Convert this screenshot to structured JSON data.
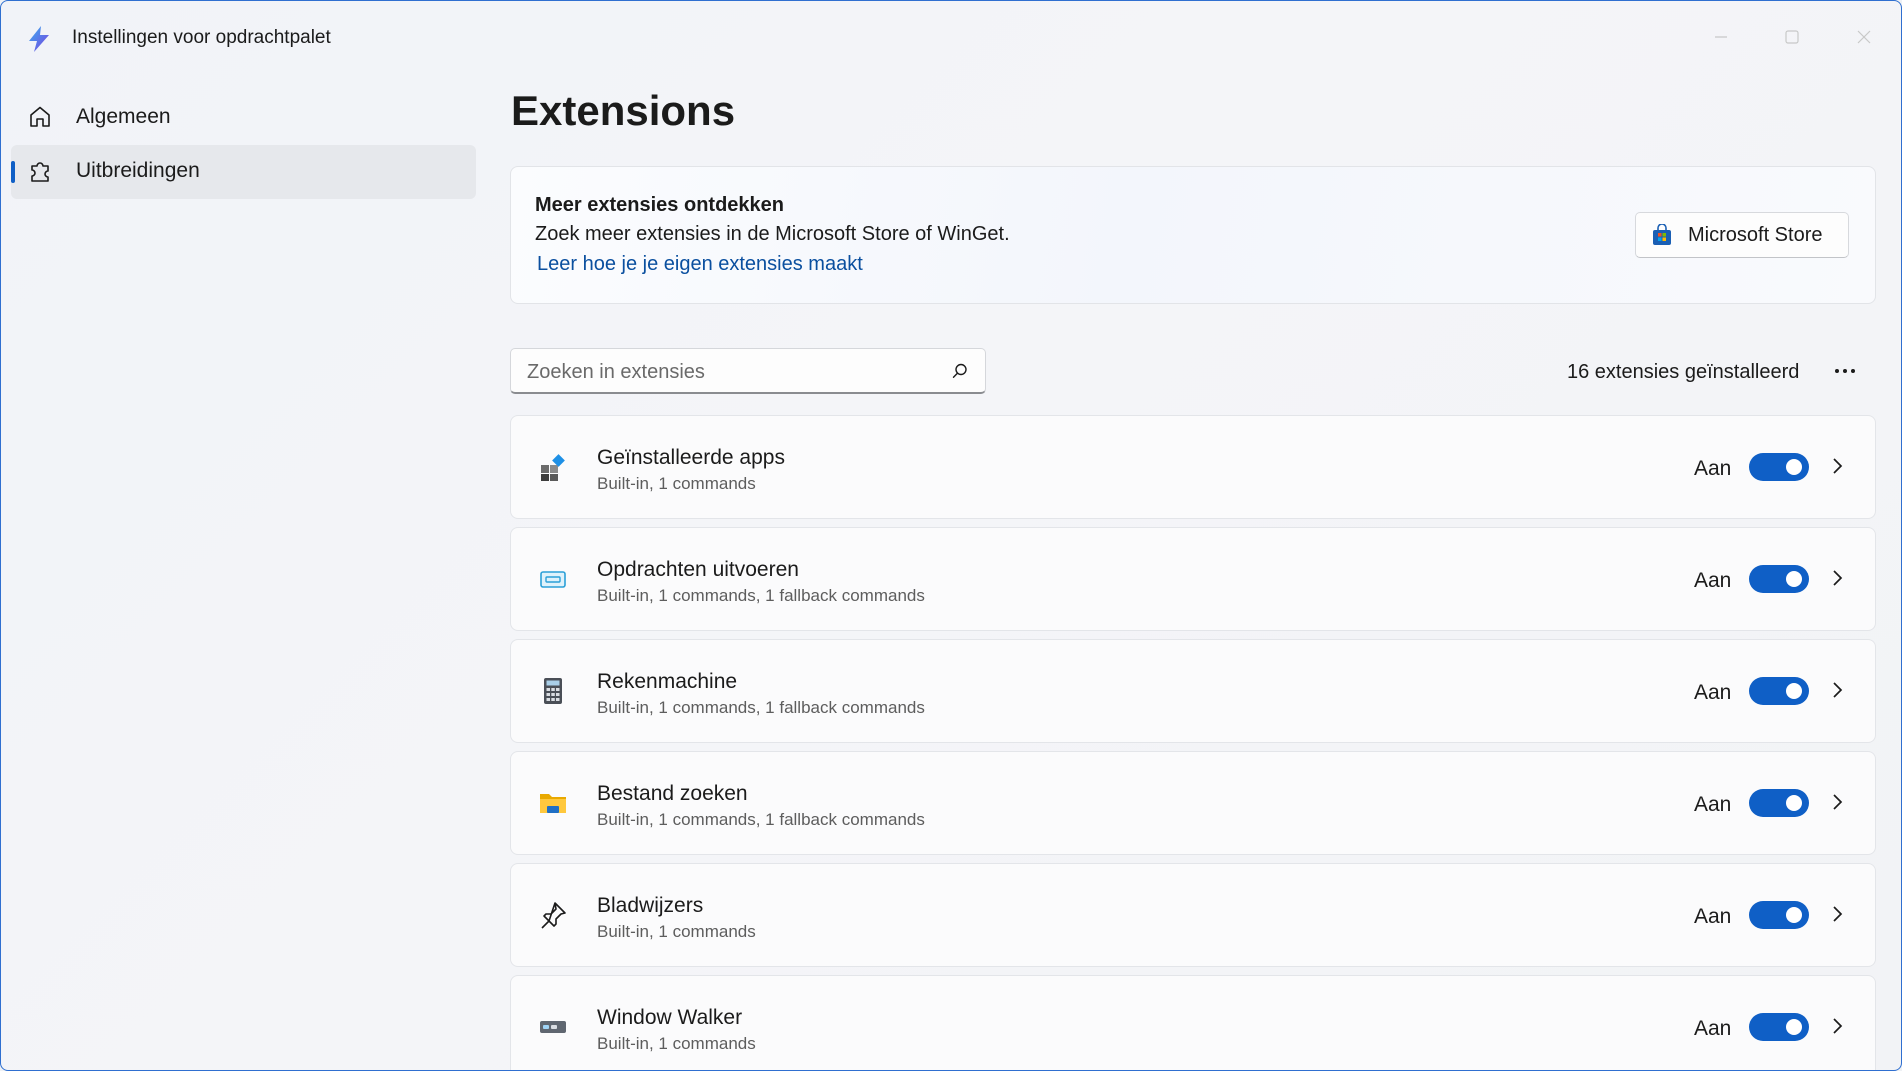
{
  "window": {
    "title": "Instellingen voor opdrachtpalet",
    "accent_color": "#0f5fc6"
  },
  "sidebar": {
    "items": [
      {
        "label": "Algemeen",
        "icon": "home-icon",
        "selected": false
      },
      {
        "label": "Uitbreidingen",
        "icon": "puzzle-icon",
        "selected": true
      }
    ]
  },
  "main": {
    "title": "Extensions",
    "discover": {
      "title": "Meer extensies ontdekken",
      "description": "Zoek meer extensies in de Microsoft Store of WinGet.",
      "link": "Leer hoe je je eigen extensies maakt",
      "store_button": "Microsoft Store"
    },
    "search": {
      "placeholder": "Zoeken in extensies",
      "value": ""
    },
    "installed_count": "16 extensies geïnstalleerd",
    "extensions": [
      {
        "name": "Geïnstalleerde apps",
        "meta": "Built-in, 1 commands",
        "state": "Aan",
        "enabled": true,
        "icon": "apps-icon"
      },
      {
        "name": "Opdrachten uitvoeren",
        "meta": "Built-in, 1 commands, 1 fallback commands",
        "state": "Aan",
        "enabled": true,
        "icon": "run-icon"
      },
      {
        "name": "Rekenmachine",
        "meta": "Built-in, 1 commands, 1 fallback commands",
        "state": "Aan",
        "enabled": true,
        "icon": "calculator-icon"
      },
      {
        "name": "Bestand zoeken",
        "meta": "Built-in, 1 commands, 1 fallback commands",
        "state": "Aan",
        "enabled": true,
        "icon": "folder-icon"
      },
      {
        "name": "Bladwijzers",
        "meta": "Built-in, 1 commands",
        "state": "Aan",
        "enabled": true,
        "icon": "pin-icon"
      },
      {
        "name": "Window Walker",
        "meta": "Built-in, 1 commands",
        "state": "Aan",
        "enabled": true,
        "icon": "window-walker-icon"
      }
    ]
  }
}
